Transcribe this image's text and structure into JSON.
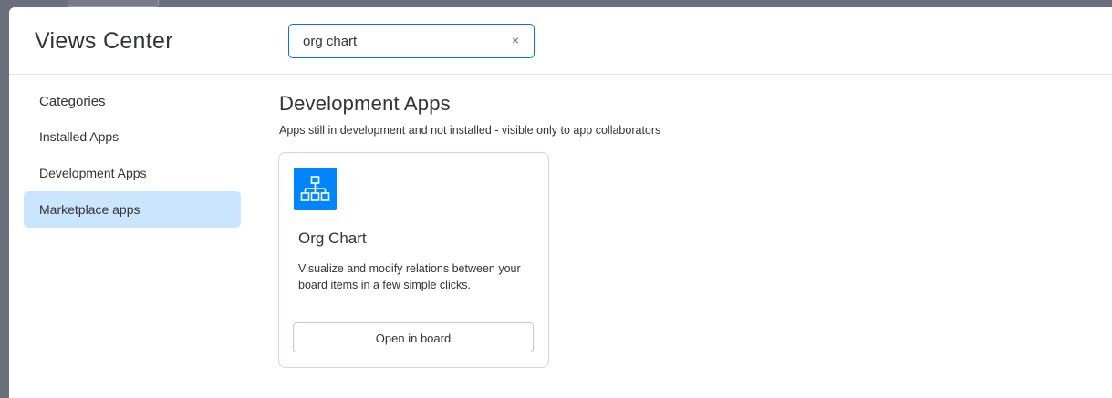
{
  "header": {
    "title": "Views Center"
  },
  "search": {
    "value": "org chart",
    "clear_glyph": "×"
  },
  "sidebar": {
    "heading": "Categories",
    "items": [
      {
        "label": "Installed Apps",
        "active": false
      },
      {
        "label": "Development Apps",
        "active": false
      },
      {
        "label": "Marketplace apps",
        "active": true
      }
    ]
  },
  "main": {
    "section_title": "Development Apps",
    "section_subtitle": "Apps still in development and not installed - visible only to app collaborators",
    "apps": [
      {
        "name": "Org Chart",
        "icon": "org-chart-icon",
        "icon_color": "#0085ff",
        "description": "Visualize and modify relations between your board items in a few simple clicks.",
        "button_label": "Open in board"
      }
    ]
  },
  "colors": {
    "accent": "#0073ea",
    "active_item_bg": "#cce5ff",
    "backdrop": "#6b6e7b"
  }
}
